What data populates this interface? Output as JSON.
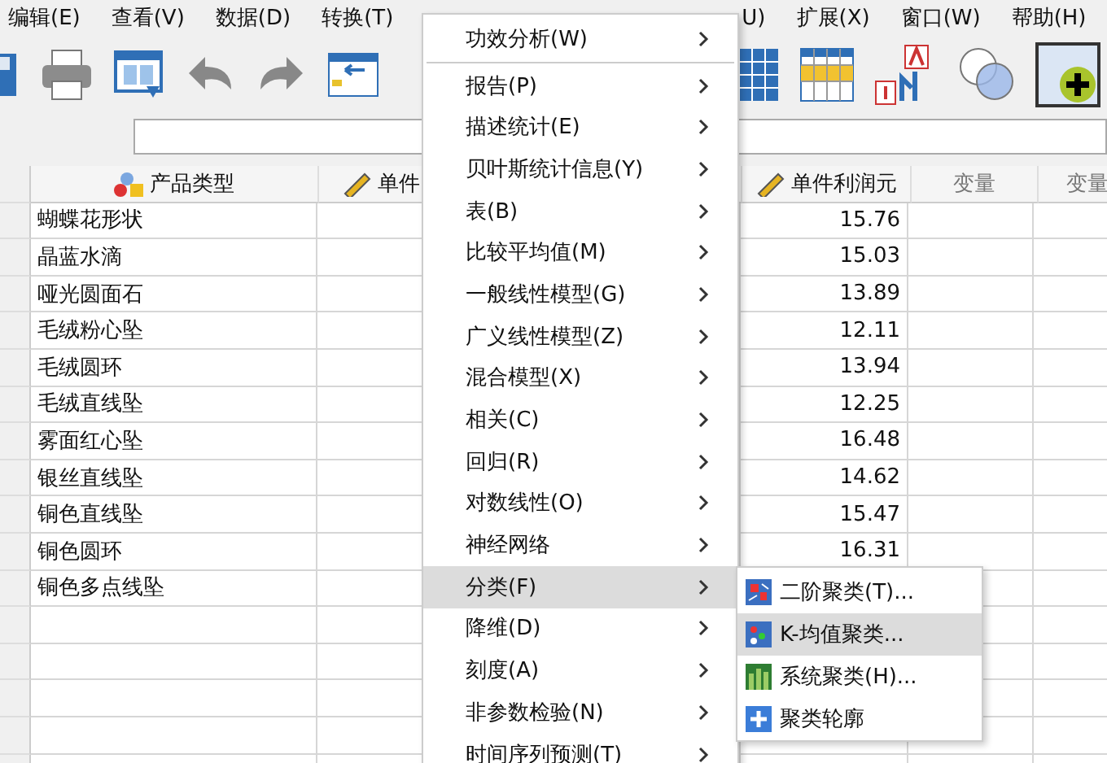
{
  "menu_bar": {
    "left": [
      {
        "label": "编辑(E)"
      },
      {
        "label": "查看(V)"
      },
      {
        "label": "数据(D)"
      },
      {
        "label": "转换(T)"
      }
    ],
    "right": [
      {
        "label": "U)"
      },
      {
        "label": "扩展(X)"
      },
      {
        "label": "窗口(W)"
      },
      {
        "label": "帮助(H)"
      }
    ]
  },
  "grid": {
    "columns": [
      {
        "label": "产品类型",
        "kind": "nominal"
      },
      {
        "label": "单件",
        "kind": "scale"
      },
      {
        "label": "单件利润元",
        "kind": "scale"
      },
      {
        "label": "变量",
        "kind": "empty"
      },
      {
        "label": "变量",
        "kind": "empty"
      }
    ],
    "rows": [
      {
        "product": "蝴蝶花形状",
        "profit": "15.76"
      },
      {
        "product": "晶蓝水滴",
        "profit": "15.03"
      },
      {
        "product": "哑光圆面石",
        "profit": "13.89"
      },
      {
        "product": "毛绒粉心坠",
        "profit": "12.11"
      },
      {
        "product": "毛绒圆环",
        "profit": "13.94"
      },
      {
        "product": "毛绒直线坠",
        "profit": "12.25"
      },
      {
        "product": "雾面红心坠",
        "profit": "16.48"
      },
      {
        "product": "银丝直线坠",
        "profit": "14.62"
      },
      {
        "product": "铜色直线坠",
        "profit": "15.47"
      },
      {
        "product": "铜色圆环",
        "profit": "16.31"
      },
      {
        "product": "铜色多点线坠"
      }
    ]
  },
  "analyze_menu": [
    {
      "label": "功效分析(W)",
      "selected": false,
      "separator_after": true
    },
    {
      "label": "报告(P)",
      "selected": false
    },
    {
      "label": "描述统计(E)",
      "selected": false
    },
    {
      "label": "贝叶斯统计信息(Y)",
      "selected": false
    },
    {
      "label": "表(B)",
      "selected": false
    },
    {
      "label": "比较平均值(M)",
      "selected": false
    },
    {
      "label": "一般线性模型(G)",
      "selected": false
    },
    {
      "label": "广义线性模型(Z)",
      "selected": false
    },
    {
      "label": "混合模型(X)",
      "selected": false
    },
    {
      "label": "相关(C)",
      "selected": false
    },
    {
      "label": "回归(R)",
      "selected": false
    },
    {
      "label": "对数线性(O)",
      "selected": false
    },
    {
      "label": "神经网络",
      "selected": false
    },
    {
      "label": "分类(F)",
      "selected": true
    },
    {
      "label": "降维(D)",
      "selected": false
    },
    {
      "label": "刻度(A)",
      "selected": false
    },
    {
      "label": "非参数检验(N)",
      "selected": false
    },
    {
      "label": "时间序列预测(T)",
      "selected": false
    }
  ],
  "classify_submenu": [
    {
      "label": "二阶聚类(T)...",
      "kind": "twostep",
      "selected": false
    },
    {
      "label": "K-均值聚类...",
      "kind": "kmeans",
      "selected": true
    },
    {
      "label": "系统聚类(H)...",
      "kind": "hierarchical",
      "selected": false
    },
    {
      "label": "聚类轮廓",
      "kind": "profile",
      "selected": false
    }
  ]
}
